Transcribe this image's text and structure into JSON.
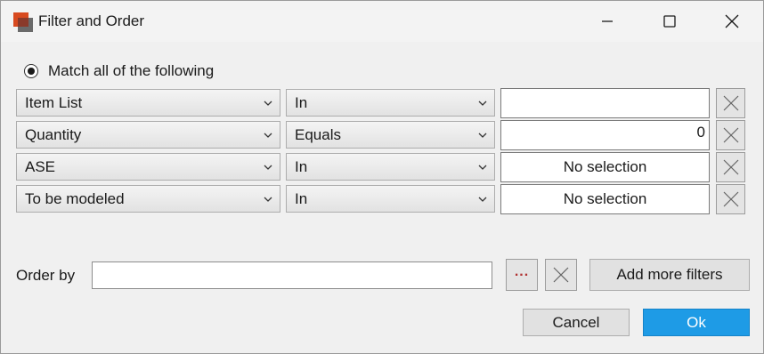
{
  "window": {
    "title": "Filter and Order",
    "controls": [
      "minimize-icon",
      "maximize-icon",
      "close-icon"
    ]
  },
  "match": {
    "label": "Match all of the following",
    "selected": true
  },
  "filters": [
    {
      "field": "Item List",
      "operator": "In",
      "value": ""
    },
    {
      "field": "Quantity",
      "operator": "Equals",
      "value": "0"
    },
    {
      "field": "ASE",
      "operator": "In",
      "value": "No selection"
    },
    {
      "field": "To be modeled",
      "operator": "In",
      "value": "No selection"
    }
  ],
  "order_by": {
    "label": "Order by",
    "value": ""
  },
  "buttons": {
    "add_more": "Add more filters",
    "cancel": "Cancel",
    "ok": "Ok"
  },
  "colors": {
    "ok_button": "#1e9be6",
    "dots_icon": "#b03030",
    "app_icon": "#d84a1f"
  }
}
